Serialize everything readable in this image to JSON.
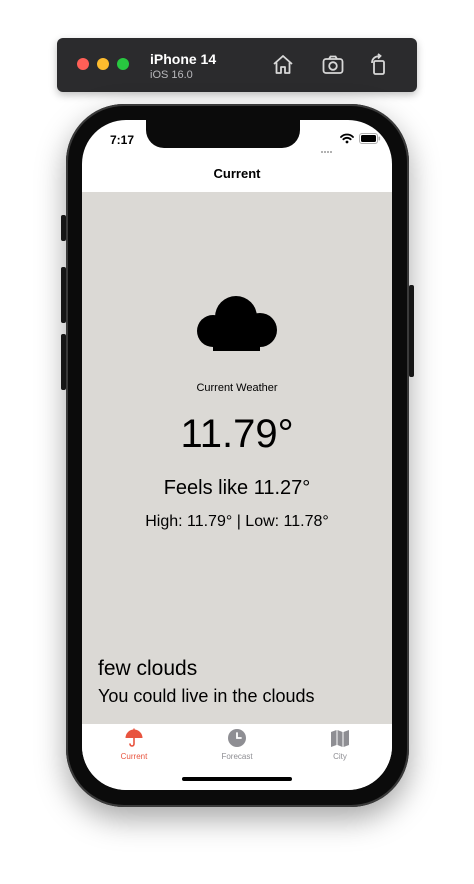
{
  "simulator": {
    "device_name": "iPhone 14",
    "os_version": "iOS 16.0",
    "icons": [
      "home-icon",
      "screenshot-icon",
      "rotate-icon"
    ]
  },
  "status_bar": {
    "time": "7:17"
  },
  "nav": {
    "title": "Current"
  },
  "weather": {
    "icon": "cloud-icon",
    "section_label": "Current Weather",
    "temperature": "11.79°",
    "feels_like": "Feels like 11.27°",
    "high_low": "High: 11.79° | Low: 11.78°",
    "description": "few clouds",
    "quip": "You could live in the clouds"
  },
  "tabs": [
    {
      "label": "Current",
      "icon": "umbrella-icon",
      "selected": true
    },
    {
      "label": "Forecast",
      "icon": "clock-icon",
      "selected": false
    },
    {
      "label": "City",
      "icon": "map-icon",
      "selected": false
    }
  ],
  "colors": {
    "accent": "#e8543f",
    "tab_inactive": "#8e8e93",
    "content_background": "#dbd9d5"
  }
}
